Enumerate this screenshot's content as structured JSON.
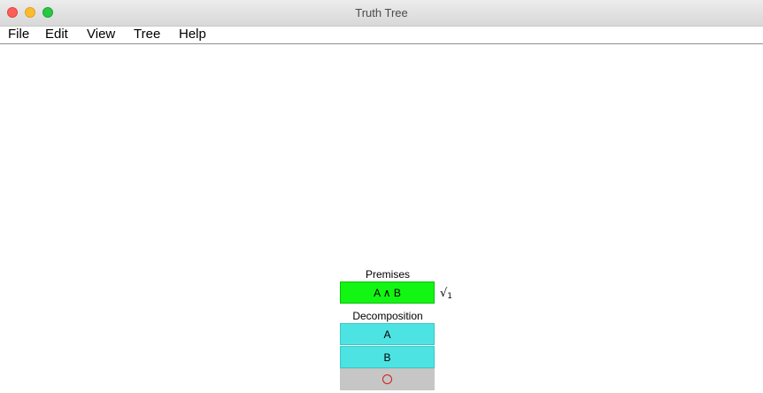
{
  "window": {
    "title": "Truth Tree"
  },
  "menu": {
    "items": [
      "File",
      "Edit",
      "View",
      "Tree",
      "Help"
    ]
  },
  "tree": {
    "premises_label": "Premises",
    "premise": {
      "formula": "A ∧ B",
      "check_mark": "√",
      "check_index": "1",
      "color": "#13f513"
    },
    "decomposition_label": "Decomposition",
    "decomposition": [
      {
        "formula": "A"
      },
      {
        "formula": "B"
      }
    ],
    "decomposition_color": "#4ee3e3",
    "terminator": {
      "icon": "open-branch-circle-icon",
      "color": "#c6c6c6",
      "mark_color": "#d21b1b"
    }
  }
}
